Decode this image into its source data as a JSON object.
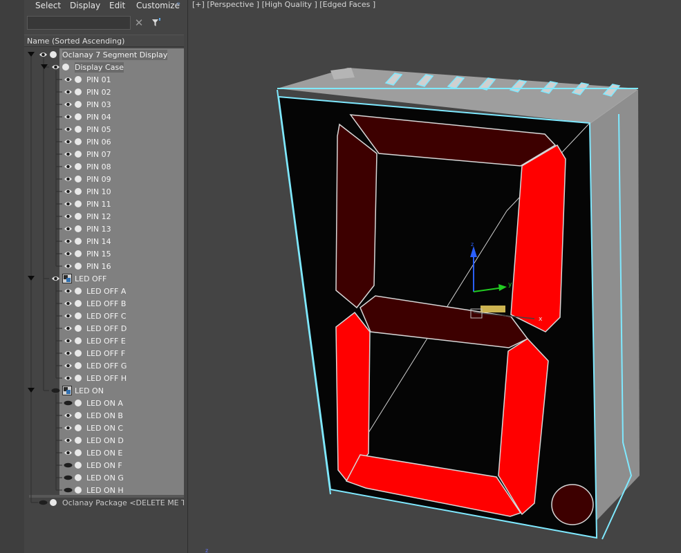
{
  "menu": {
    "items": [
      "Select",
      "Display",
      "Edit",
      "Customize"
    ],
    "overflow": "»"
  },
  "search": {
    "value": "",
    "placeholder": ""
  },
  "column_header": "Name (Sorted Ascending)",
  "tree": {
    "root": "Oclanay 7 Segment Display",
    "display_case": {
      "label": "Display Case",
      "pins": [
        "PIN 01",
        "PIN 02",
        "PIN 03",
        "PIN 04",
        "PIN 05",
        "PIN 06",
        "PIN 07",
        "PIN 08",
        "PIN 09",
        "PIN 10",
        "PIN 11",
        "PIN 12",
        "PIN 13",
        "PIN 14",
        "PIN 15",
        "PIN 16"
      ]
    },
    "led_off": {
      "label": "LED OFF",
      "items": [
        "LED OFF A",
        "LED OFF B",
        "LED OFF C",
        "LED OFF D",
        "LED OFF E",
        "LED OFF F",
        "LED OFF G",
        "LED OFF H"
      ]
    },
    "led_on": {
      "label": "LED ON",
      "items": [
        {
          "label": "LED ON A",
          "visible": false
        },
        {
          "label": "LED ON B",
          "visible": true
        },
        {
          "label": "LED ON C",
          "visible": true
        },
        {
          "label": "LED ON D",
          "visible": true
        },
        {
          "label": "LED ON E",
          "visible": true
        },
        {
          "label": "LED ON F",
          "visible": false
        },
        {
          "label": "LED ON G",
          "visible": false
        },
        {
          "label": "LED ON H",
          "visible": false
        }
      ]
    },
    "package": "Oclanay Package <DELETE ME TO O"
  },
  "viewport": {
    "label_parts": [
      "[+]",
      "[Perspective ]",
      "[High Quality ]",
      "[Edged Faces ]"
    ],
    "gizmo": {
      "x_label": "x",
      "y_label": "y",
      "z_label": "z"
    },
    "grid_axis_label": "z"
  },
  "colors": {
    "segment_on": "#ff0000",
    "segment_off": "#3d0000",
    "edge_highlight": "#7fe9ff",
    "case_body": "#8a8a8a"
  }
}
